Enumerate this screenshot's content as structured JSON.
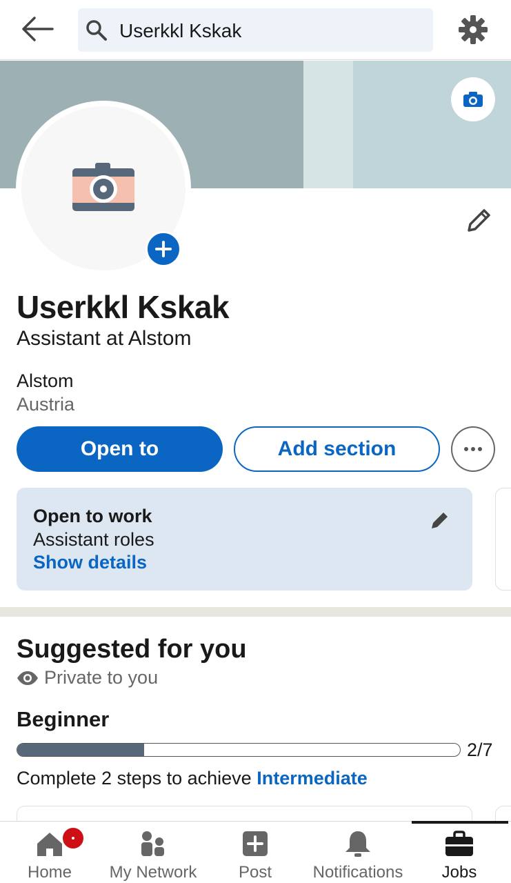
{
  "search": {
    "query": "Userkkl Kskak"
  },
  "profile": {
    "name": "Userkkl Kskak",
    "headline": "Assistant at Alstom",
    "company": "Alstom",
    "location": "Austria"
  },
  "actions": {
    "open_to": "Open to",
    "add_section": "Add section"
  },
  "open_to_work": {
    "title": "Open to work",
    "roles": "Assistant roles",
    "show_details": "Show details"
  },
  "suggested": {
    "title": "Suggested for you",
    "privacy": "Private to you",
    "level": "Beginner",
    "progress_label": "2/7",
    "progress_fraction": 0.286,
    "complete_text": "Complete 2 steps to achieve ",
    "next_level": "Intermediate"
  },
  "nav": {
    "items": [
      {
        "label": "Home",
        "icon": "home-icon"
      },
      {
        "label": "My Network",
        "icon": "network-icon"
      },
      {
        "label": "Post",
        "icon": "post-icon"
      },
      {
        "label": "Notifications",
        "icon": "bell-icon"
      },
      {
        "label": "Jobs",
        "icon": "briefcase-icon"
      }
    ]
  },
  "colors": {
    "accent": "#0a66c2",
    "banner": "#c0d5d9",
    "card_bg": "#dde7f1",
    "badge": "#cc1016"
  }
}
